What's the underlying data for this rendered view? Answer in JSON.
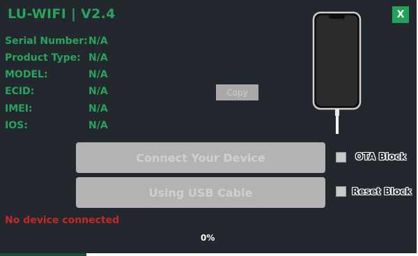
{
  "app": {
    "title": "LU-WIFI | V2.4",
    "close_label": "X"
  },
  "info": [
    {
      "label": "Serial Number:",
      "value": "N/A"
    },
    {
      "label": "Product Type:",
      "value": "N/A"
    },
    {
      "label": "MODEL:",
      "value": "N/A"
    },
    {
      "label": "ECID:",
      "value": "N/A"
    },
    {
      "label": "IMEI:",
      "value": "N/A"
    },
    {
      "label": "IOS:",
      "value": "N/A"
    }
  ],
  "buttons": {
    "copy": "Copy",
    "connect": "Connect Your Device",
    "usb": "Using USB Cable"
  },
  "options": {
    "ota_block": {
      "label": "OTA Block",
      "checked": false
    },
    "reset_block": {
      "label": "Reset Block",
      "checked": false
    }
  },
  "status": {
    "message": "No device connected",
    "progress": "0%",
    "progress_value": 0
  },
  "colors": {
    "background": "#22282d",
    "accent": "#2aa35e",
    "error": "#c62828",
    "button_disabled": "#b3b3b3"
  },
  "icons": {
    "device": "iphone-icon"
  }
}
